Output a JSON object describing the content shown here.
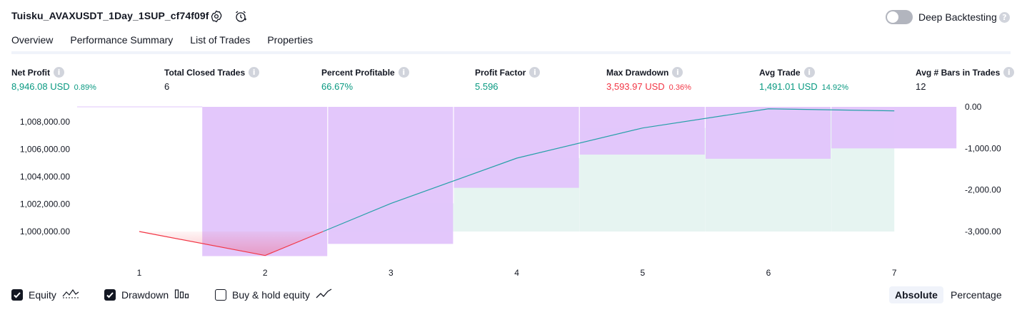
{
  "header": {
    "title": "Tuisku_AVAXUSDT_1Day_1SUP_cf74f09f",
    "deep_backtesting_label": "Deep Backtesting",
    "deep_backtesting_on": false
  },
  "tabs": [
    {
      "label": "Overview",
      "active": true
    },
    {
      "label": "Performance Summary",
      "active": false
    },
    {
      "label": "List of Trades",
      "active": false
    },
    {
      "label": "Properties",
      "active": false
    }
  ],
  "metrics": [
    {
      "label": "Net Profit",
      "value": "8,946.08 USD",
      "pct": "0.89%",
      "color": "green"
    },
    {
      "label": "Total Closed Trades",
      "value": "6",
      "pct": "",
      "color": "black"
    },
    {
      "label": "Percent Profitable",
      "value": "66.67%",
      "pct": "",
      "color": "green"
    },
    {
      "label": "Profit Factor",
      "value": "5.596",
      "pct": "",
      "color": "green"
    },
    {
      "label": "Max Drawdown",
      "value": "3,593.97 USD",
      "pct": "0.36%",
      "color": "red"
    },
    {
      "label": "Avg Trade",
      "value": "1,491.01 USD",
      "pct": "14.92%",
      "color": "green"
    },
    {
      "label": "Avg # Bars in Trades",
      "value": "12",
      "pct": "",
      "color": "black"
    }
  ],
  "chart_data": {
    "type": "area",
    "x": [
      1,
      2,
      3,
      4,
      5,
      6,
      7
    ],
    "series": [
      {
        "name": "Equity",
        "axis": "left",
        "values": [
          1000000.0,
          998250.0,
          1002050.0,
          1005350.0,
          1007550.0,
          1008946.08,
          1008800.0
        ]
      },
      {
        "name": "Drawdown",
        "axis": "right",
        "values": [
          0.0,
          -3593.97,
          -3300.0,
          -1950.0,
          -1150.0,
          -1250.0,
          -1000.0
        ]
      }
    ],
    "left_ticks": [
      "1,000,000.00",
      "1,002,000.00",
      "1,004,000.00",
      "1,006,000.00",
      "1,008,000.00"
    ],
    "left_tick_values": [
      1000000,
      1002000,
      1004000,
      1006000,
      1008000
    ],
    "right_ticks": [
      "0.00",
      "-1,000.00",
      "-2,000.00",
      "-3,000.00"
    ],
    "right_tick_values": [
      0,
      -1000,
      -2000,
      -3000
    ],
    "x_ticks": [
      "1",
      "2",
      "3",
      "4",
      "5",
      "6",
      "7"
    ],
    "colors": {
      "equity_line": "#26a0a8",
      "loss_line": "#f23645",
      "drawdown_bar": "#e1c4fb",
      "equity_fill": "#e6f4f1"
    }
  },
  "legend": [
    {
      "label": "Equity",
      "checked": true,
      "icon": "equity-icon"
    },
    {
      "label": "Drawdown",
      "checked": true,
      "icon": "drawdown-bars-icon"
    },
    {
      "label": "Buy & hold equity",
      "checked": false,
      "icon": "buy-hold-line-icon"
    }
  ],
  "view_buttons": {
    "absolute": "Absolute",
    "percentage": "Percentage",
    "selected": "absolute"
  }
}
